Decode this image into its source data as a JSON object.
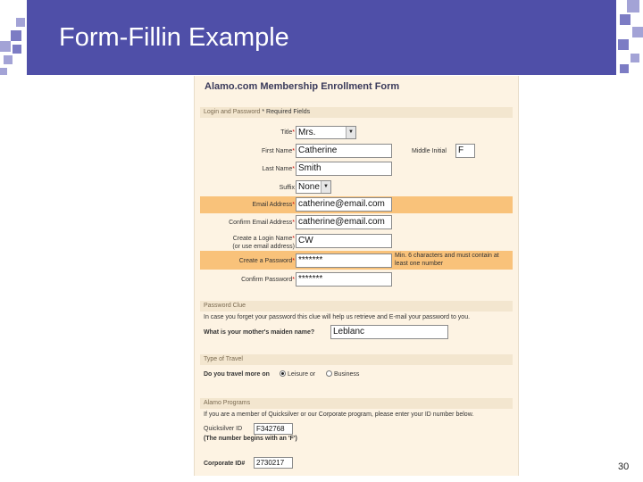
{
  "slide": {
    "title": "Form-Fillin Example",
    "page_number": "30"
  },
  "form": {
    "title": "Alamo.com Membership Enrollment Form",
    "sections": {
      "login": "Login and Password",
      "login_required": "* Required Fields",
      "clue": "Password Clue",
      "travel": "Type of Travel",
      "programs": "Alamo Programs"
    },
    "labels": {
      "title": "Title",
      "first_name": "First Name",
      "middle_initial": "Middle Initial",
      "last_name": "Last Name",
      "suffix": "Suffix",
      "email": "Email Address",
      "confirm_email": "Confirm Email Address",
      "login_name_1": "Create a Login Name",
      "login_name_2": "(or use email address)",
      "password": "Create a Password",
      "confirm_password": "Confirm Password",
      "clue_help": "In case you forget your password this clue will help us retrieve and E-mail your password to you.",
      "clue_question": "What is your mother's maiden name?",
      "travel_question": "Do you travel more on",
      "leisure": "Leisure or",
      "business": "Business",
      "programs_help": "If you are a member of Quicksilver or our Corporate program, please enter your ID number below.",
      "quicksilver": "Quicksilver ID",
      "quicksilver_note": "(The number begins with an 'F')",
      "corporate": "Corporate ID#"
    },
    "required_marker": "*",
    "values": {
      "title": "Mrs.",
      "first_name": "Catherine",
      "middle_initial": "F",
      "last_name": "Smith",
      "suffix": "None",
      "email": "catherine@email.com",
      "confirm_email": "catherine@email.com",
      "login_name": "CW",
      "password": "*******",
      "confirm_password": "*******",
      "clue": "Leblanc",
      "quicksilver_id": "F342768",
      "corporate_id": "2730217"
    },
    "password_hint": "Min. 6 characters and must contain at least one number",
    "travel_selected": "Leisure"
  }
}
